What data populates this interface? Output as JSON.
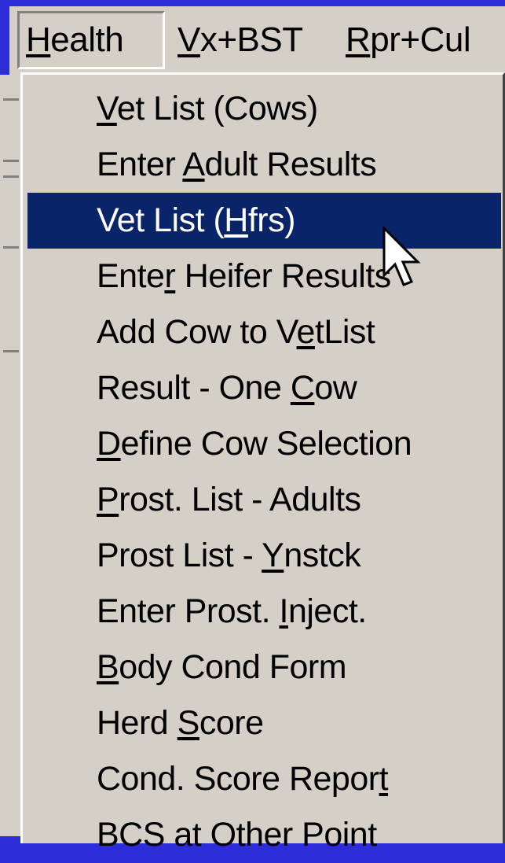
{
  "menubar": {
    "items": [
      {
        "pre": "",
        "ul": "H",
        "post": "ealth"
      },
      {
        "pre": "",
        "ul": "V",
        "post": "x+BST"
      },
      {
        "pre": "",
        "ul": "R",
        "post": "pr+Cul"
      }
    ]
  },
  "menu": {
    "items": [
      {
        "pre": "",
        "ul": "V",
        "post": "et List (Cows)"
      },
      {
        "pre": "Enter ",
        "ul": "A",
        "post": "dult Results"
      },
      {
        "pre": "Vet List (",
        "ul": "H",
        "post": "frs)"
      },
      {
        "pre": "Ente",
        "ul": "r",
        "post": " Heifer Results"
      },
      {
        "pre": "Add Cow to V",
        "ul": "e",
        "post": "tList"
      },
      {
        "pre": "Result - One ",
        "ul": "C",
        "post": "ow"
      },
      {
        "pre": "",
        "ul": "D",
        "post": "efine Cow Selection"
      },
      {
        "pre": "",
        "ul": "P",
        "post": "rost. List - Adults"
      },
      {
        "pre": "Prost List - ",
        "ul": "Y",
        "post": "nstck"
      },
      {
        "pre": "Enter Prost. ",
        "ul": "I",
        "post": "nject."
      },
      {
        "pre": "",
        "ul": "B",
        "post": "ody Cond Form"
      },
      {
        "pre": "Herd ",
        "ul": "S",
        "post": "core"
      },
      {
        "pre": "Cond. Score Repor",
        "ul": "t",
        "post": ""
      },
      {
        "pre": "BCS at Other Point",
        "ul": "",
        "post": ""
      }
    ],
    "selected_index": 2
  },
  "colors": {
    "desktop": "#2c2cd8",
    "menu_face": "#d4d0c8",
    "highlight": "#0a246a",
    "highlight_text": "#ffffff"
  },
  "icons": {
    "cursor": "arrow-pointer-icon"
  }
}
